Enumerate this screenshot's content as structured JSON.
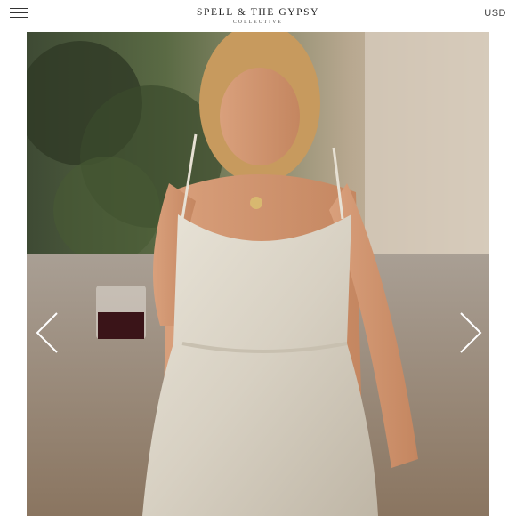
{
  "header": {
    "menu_icon": "hamburger-menu-icon",
    "brand_name": "SPELL & THE GYPSY",
    "brand_sub": "COLLECTIVE",
    "currency": "USD"
  },
  "carousel": {
    "prev_icon": "chevron-left-icon",
    "next_icon": "chevron-right-icon"
  },
  "colors": {
    "arrow": "#ffffff",
    "text": "#222222"
  }
}
